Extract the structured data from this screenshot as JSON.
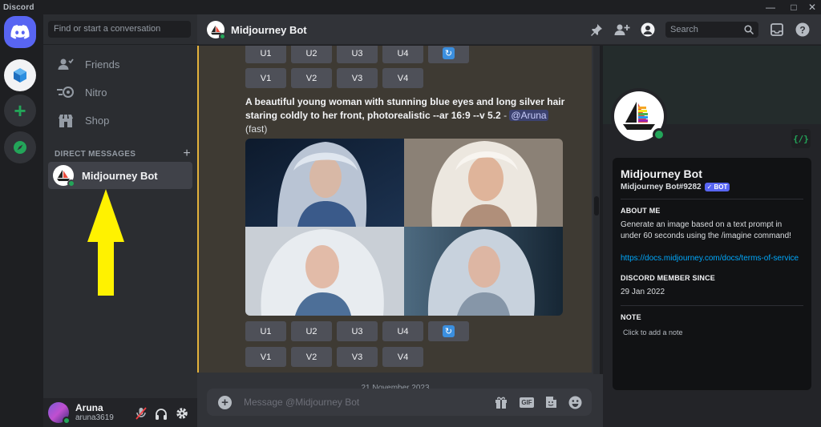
{
  "window": {
    "title": "Discord"
  },
  "sidebar": {
    "search_placeholder": "Find or start a conversation",
    "nav": [
      {
        "label": "Friends"
      },
      {
        "label": "Nitro"
      },
      {
        "label": "Shop"
      }
    ],
    "dm_header": "DIRECT MESSAGES",
    "dm_items": [
      {
        "label": "Midjourney Bot"
      }
    ]
  },
  "user": {
    "name": "Aruna",
    "tag": "aruna3619"
  },
  "chat": {
    "title": "Midjourney Bot",
    "search_placeholder": "Search",
    "upscale_buttons": [
      "U1",
      "U2",
      "U3",
      "U4"
    ],
    "variation_buttons": [
      "V1",
      "V2",
      "V3",
      "V4"
    ],
    "prompt_text": "A beautiful young woman with stunning blue eyes and long silver hair staring coldly to her front, photorealistic --ar 16:9 --v 5.2",
    "prompt_separator": " - ",
    "mention": "@Aruna",
    "speed": "(fast)",
    "date_divider": "21 November 2023",
    "composer_placeholder": "Message @Midjourney Bot",
    "gif_label": "GIF"
  },
  "profile": {
    "name": "Midjourney Bot",
    "tag": "Midjourney Bot#9282",
    "badge": "✓ BOT",
    "about_title": "ABOUT ME",
    "about_text": "Generate an image based on a text prompt in under 60 seconds using the /imagine command!",
    "link": "https://docs.midjourney.com/docs/terms-of-service",
    "member_since_title": "DISCORD MEMBER SINCE",
    "member_since": "29 Jan 2022",
    "note_title": "NOTE",
    "note_placeholder": "Click to add a note",
    "code_icon": "{/}"
  },
  "colors": {
    "blurple": "#5865f2",
    "online": "#23a559",
    "highlight_bar": "#e3b23c",
    "link": "#00a8fc",
    "arrow": "#fff200"
  }
}
